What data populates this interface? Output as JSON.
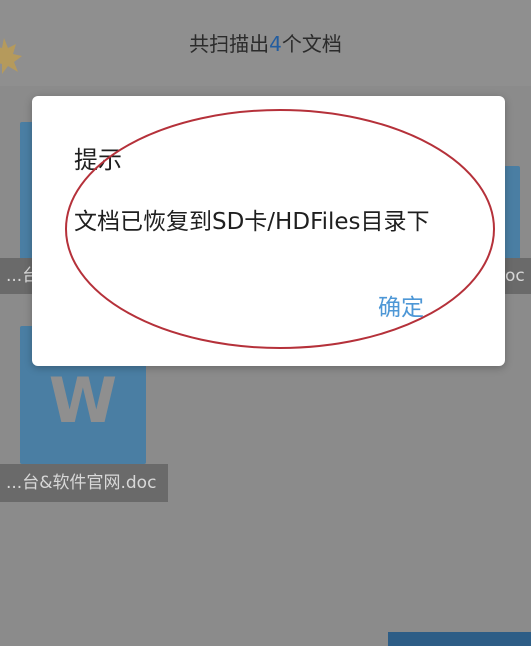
{
  "header": {
    "title_prefix": "共扫描出",
    "count": "4",
    "title_suffix": "个文档"
  },
  "documents": [
    {
      "label": "...台",
      "icon_letter": ""
    },
    {
      "label": "...doc",
      "icon_letter": ""
    },
    {
      "label": "...台&软件官网.doc",
      "icon_letter": "W"
    }
  ],
  "dialog": {
    "title": "提示",
    "message": "文档已恢复到SD卡/HDFiles目录下",
    "confirm_label": "确定"
  },
  "colors": {
    "accent": "#4d97d6",
    "count_highlight": "#235d9f",
    "annotation_ellipse": "#b5313a",
    "doc_icon": "#4a7ea3"
  }
}
